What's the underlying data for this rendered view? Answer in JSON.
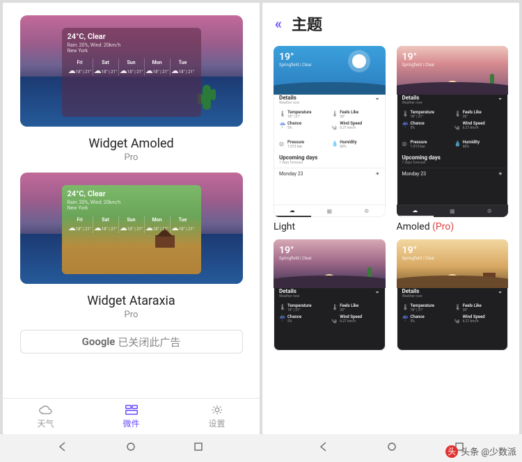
{
  "left": {
    "w1_title": "Widget Amoled",
    "w2_title": "Widget Ataraxia",
    "pro": "Pro",
    "ad_brand": "Google",
    "ad_text": "已关闭此广告",
    "panel": {
      "headline": "24°C, Clear",
      "sub1": "Rain: 20%, Wind: 20km/h",
      "sub2": "New York",
      "days": [
        {
          "n": "Fri",
          "t": "18° | 21°"
        },
        {
          "n": "Sat",
          "t": "18° | 21°"
        },
        {
          "n": "Sun",
          "t": "18° | 21°"
        },
        {
          "n": "Mon",
          "t": "18° | 21°"
        },
        {
          "n": "Tue",
          "t": "18° | 21°"
        }
      ]
    },
    "tabs": {
      "weather": "天气",
      "widgets": "微件",
      "settings": "设置"
    }
  },
  "right": {
    "title": "主题",
    "labels": {
      "light": "Light",
      "amoled": "Amoled",
      "pro": "(Pro)"
    },
    "preview": {
      "deg": "19°",
      "loc": "Springfield | Clear",
      "details": "Details",
      "details_sub": "Weather now",
      "metrics": [
        {
          "k": "Temperature",
          "v": "18° | 21°",
          "i": "🌡"
        },
        {
          "k": "Feels Like",
          "v": "20°",
          "i": "🌡"
        },
        {
          "k": "Chance",
          "v": "5%",
          "i": "☔"
        },
        {
          "k": "Wind Speed",
          "v": "6.21 km/h",
          "i": "༄"
        },
        {
          "k": "Pressure",
          "v": "1.013 bar",
          "i": "◎"
        },
        {
          "k": "Humidity",
          "v": "60%",
          "i": "💧"
        }
      ],
      "upcoming": "Upcoming days",
      "upcoming_sub": "7 days forecast",
      "day": "Monday 23",
      "nav": {
        "weather": "Weather"
      }
    }
  },
  "watermark": "头条 @少数派"
}
